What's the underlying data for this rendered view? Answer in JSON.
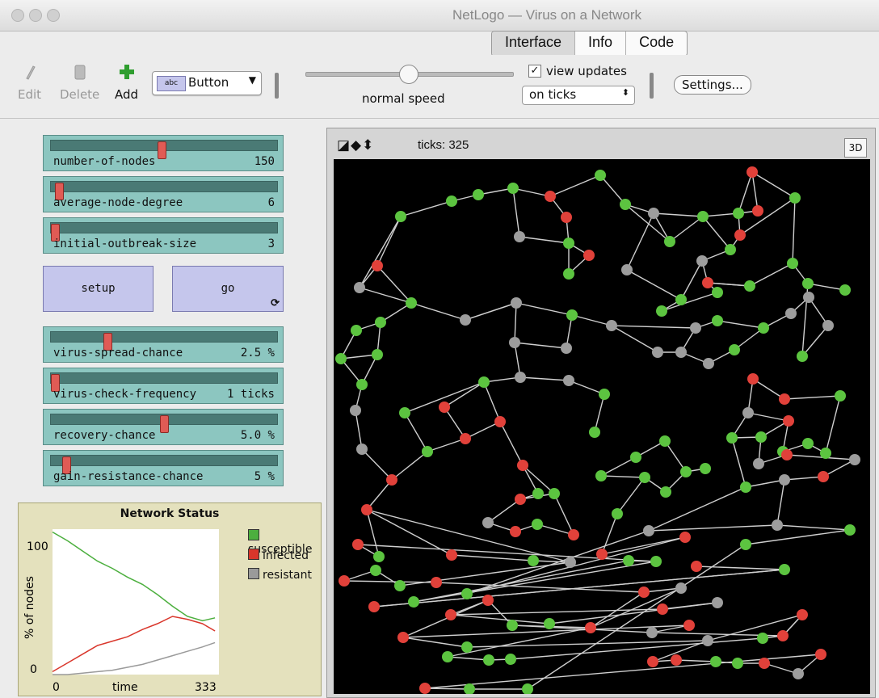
{
  "window": {
    "title": "NetLogo — Virus on a Network"
  },
  "tabs": [
    {
      "label": "Interface"
    },
    {
      "label": "Info"
    },
    {
      "label": "Code"
    }
  ],
  "toolbar": {
    "edit_label": "Edit",
    "delete_label": "Delete",
    "add_label": "Add",
    "widget_type_badge": "abc",
    "widget_type": "Button",
    "speed_label": "normal speed",
    "speed_position": 0.5,
    "view_updates_label": "view updates",
    "view_updates_checked": true,
    "update_mode": "on ticks",
    "settings_label": "Settings..."
  },
  "sliders": [
    {
      "name": "number-of-nodes",
      "value": "150",
      "position": 0.49
    },
    {
      "name": "average-node-degree",
      "value": "6",
      "position": 0.02
    },
    {
      "name": "initial-outbreak-size",
      "value": "3",
      "position": 0.0
    },
    {
      "name": "virus-spread-chance",
      "value": "2.5 %",
      "position": 0.24
    },
    {
      "name": "virus-check-frequency",
      "value": "1 ticks",
      "position": 0.0
    },
    {
      "name": "recovery-chance",
      "value": "5.0 %",
      "position": 0.5
    },
    {
      "name": "gain-resistance-chance",
      "value": "5 %",
      "position": 0.05
    }
  ],
  "buttons": {
    "setup": "setup",
    "go": "go",
    "forever_icon": "forever-icon"
  },
  "plot": {
    "title": "Network Status",
    "ylabel": "% of nodes",
    "xlabel": "time",
    "y_min_label": "0",
    "y_max_label": "100",
    "x_min_label": "0",
    "x_max_label": "333",
    "legend": [
      {
        "name": "susceptible",
        "color": "#4caf3e"
      },
      {
        "name": "infected",
        "color": "#d9362b"
      },
      {
        "name": "resistant",
        "color": "#9a9a9a"
      }
    ]
  },
  "chart_data": {
    "type": "line",
    "title": "Network Status",
    "xlabel": "time",
    "ylabel": "% of nodes",
    "xlim": [
      0,
      333
    ],
    "ylim": [
      0,
      100
    ],
    "x": [
      0,
      30,
      60,
      90,
      120,
      150,
      180,
      210,
      240,
      270,
      300,
      325
    ],
    "series": [
      {
        "name": "susceptible",
        "values": [
          98,
          92,
          85,
          78,
          73,
          67,
          62,
          55,
          47,
          40,
          37,
          39
        ]
      },
      {
        "name": "infected",
        "values": [
          2,
          8,
          14,
          20,
          23,
          26,
          31,
          35,
          40,
          38,
          35,
          30
        ]
      },
      {
        "name": "resistant",
        "values": [
          0,
          0,
          1,
          2,
          3,
          5,
          7,
          10,
          13,
          16,
          19,
          22
        ]
      }
    ],
    "grid": false,
    "legend": "right"
  },
  "view": {
    "ticks_label": "ticks: 325",
    "btn_3d": "3D",
    "background": "#000000"
  },
  "network": {
    "colors": {
      "s": "#5cc440",
      "i": "#e1413a",
      "r": "#9d9d9d"
    },
    "nodes": [
      [
        495,
        267,
        "s"
      ],
      [
        558,
        248,
        "s"
      ],
      [
        591,
        240,
        "s"
      ],
      [
        634,
        232,
        "s"
      ],
      [
        680,
        242,
        "i"
      ],
      [
        700,
        268,
        "i"
      ],
      [
        642,
        292,
        "r"
      ],
      [
        703,
        300,
        "s"
      ],
      [
        728,
        315,
        "i"
      ],
      [
        703,
        338,
        "s"
      ],
      [
        742,
        216,
        "s"
      ],
      [
        773,
        252,
        "s"
      ],
      [
        808,
        263,
        "r"
      ],
      [
        869,
        267,
        "s"
      ],
      [
        913,
        263,
        "s"
      ],
      [
        930,
        212,
        "i"
      ],
      [
        983,
        244,
        "s"
      ],
      [
        937,
        260,
        "i"
      ],
      [
        915,
        290,
        "i"
      ],
      [
        828,
        298,
        "s"
      ],
      [
        903,
        308,
        "s"
      ],
      [
        868,
        322,
        "r"
      ],
      [
        875,
        349,
        "i"
      ],
      [
        980,
        325,
        "s"
      ],
      [
        999,
        350,
        "s"
      ],
      [
        1045,
        358,
        "s"
      ],
      [
        927,
        353,
        "s"
      ],
      [
        775,
        333,
        "r"
      ],
      [
        842,
        370,
        "s"
      ],
      [
        818,
        384,
        "s"
      ],
      [
        887,
        361,
        "s"
      ],
      [
        466,
        328,
        "i"
      ],
      [
        444,
        355,
        "r"
      ],
      [
        508,
        374,
        "s"
      ],
      [
        470,
        398,
        "s"
      ],
      [
        440,
        408,
        "s"
      ],
      [
        421,
        443,
        "s"
      ],
      [
        466,
        438,
        "s"
      ],
      [
        447,
        475,
        "s"
      ],
      [
        439,
        507,
        "r"
      ],
      [
        447,
        555,
        "r"
      ],
      [
        575,
        395,
        "r"
      ],
      [
        638,
        374,
        "r"
      ],
      [
        707,
        389,
        "s"
      ],
      [
        756,
        402,
        "r"
      ],
      [
        860,
        405,
        "r"
      ],
      [
        887,
        396,
        "s"
      ],
      [
        944,
        405,
        "s"
      ],
      [
        978,
        387,
        "r"
      ],
      [
        1000,
        367,
        "r"
      ],
      [
        1024,
        402,
        "r"
      ],
      [
        992,
        440,
        "s"
      ],
      [
        636,
        423,
        "r"
      ],
      [
        700,
        430,
        "r"
      ],
      [
        813,
        435,
        "r"
      ],
      [
        842,
        435,
        "r"
      ],
      [
        876,
        449,
        "r"
      ],
      [
        908,
        432,
        "s"
      ],
      [
        643,
        466,
        "r"
      ],
      [
        703,
        470,
        "r"
      ],
      [
        747,
        487,
        "s"
      ],
      [
        598,
        472,
        "s"
      ],
      [
        735,
        534,
        "s"
      ],
      [
        549,
        503,
        "i"
      ],
      [
        575,
        542,
        "i"
      ],
      [
        618,
        521,
        "i"
      ],
      [
        528,
        558,
        "s"
      ],
      [
        500,
        510,
        "s"
      ],
      [
        931,
        468,
        "i"
      ],
      [
        970,
        493,
        "i"
      ],
      [
        1039,
        489,
        "s"
      ],
      [
        925,
        510,
        "r"
      ],
      [
        975,
        520,
        "i"
      ],
      [
        941,
        540,
        "s"
      ],
      [
        905,
        541,
        "s"
      ],
      [
        968,
        558,
        "s"
      ],
      [
        999,
        548,
        "s"
      ],
      [
        1021,
        560,
        "s"
      ],
      [
        938,
        573,
        "r"
      ],
      [
        973,
        562,
        "i"
      ],
      [
        1057,
        568,
        "r"
      ],
      [
        1018,
        589,
        "i"
      ],
      [
        970,
        593,
        "r"
      ],
      [
        922,
        602,
        "s"
      ],
      [
        822,
        545,
        "s"
      ],
      [
        848,
        583,
        "s"
      ],
      [
        872,
        579,
        "s"
      ],
      [
        786,
        565,
        "s"
      ],
      [
        743,
        588,
        "s"
      ],
      [
        797,
        590,
        "s"
      ],
      [
        823,
        608,
        "s"
      ],
      [
        763,
        635,
        "s"
      ],
      [
        484,
        593,
        "i"
      ],
      [
        646,
        575,
        "i"
      ],
      [
        665,
        610,
        "s"
      ],
      [
        643,
        617,
        "i"
      ],
      [
        685,
        610,
        "s"
      ],
      [
        603,
        646,
        "r"
      ],
      [
        637,
        657,
        "i"
      ],
      [
        664,
        648,
        "s"
      ],
      [
        709,
        661,
        "i"
      ],
      [
        453,
        630,
        "i"
      ],
      [
        961,
        649,
        "r"
      ],
      [
        1051,
        655,
        "s"
      ],
      [
        922,
        673,
        "s"
      ],
      [
        802,
        656,
        "r"
      ],
      [
        847,
        664,
        "i"
      ],
      [
        744,
        685,
        "i"
      ],
      [
        777,
        693,
        "s"
      ],
      [
        811,
        694,
        "s"
      ],
      [
        442,
        673,
        "i"
      ],
      [
        468,
        688,
        "s"
      ],
      [
        558,
        686,
        "i"
      ],
      [
        659,
        693,
        "s"
      ],
      [
        705,
        695,
        "r"
      ],
      [
        425,
        718,
        "i"
      ],
      [
        464,
        705,
        "s"
      ],
      [
        494,
        724,
        "s"
      ],
      [
        539,
        720,
        "i"
      ],
      [
        796,
        732,
        "i"
      ],
      [
        842,
        727,
        "r"
      ],
      [
        861,
        700,
        "i"
      ],
      [
        970,
        704,
        "s"
      ],
      [
        462,
        750,
        "i"
      ],
      [
        511,
        744,
        "s"
      ],
      [
        577,
        734,
        "s"
      ],
      [
        603,
        742,
        "i"
      ],
      [
        557,
        760,
        "i"
      ],
      [
        819,
        753,
        "i"
      ],
      [
        887,
        745,
        "r"
      ],
      [
        679,
        771,
        "s"
      ],
      [
        730,
        776,
        "i"
      ],
      [
        633,
        773,
        "s"
      ],
      [
        806,
        782,
        "r"
      ],
      [
        852,
        773,
        "i"
      ],
      [
        498,
        788,
        "i"
      ],
      [
        577,
        800,
        "s"
      ],
      [
        553,
        812,
        "s"
      ],
      [
        604,
        816,
        "s"
      ],
      [
        631,
        815,
        "s"
      ],
      [
        943,
        789,
        "s"
      ],
      [
        968,
        786,
        "i"
      ],
      [
        992,
        760,
        "i"
      ],
      [
        875,
        792,
        "r"
      ],
      [
        807,
        818,
        "i"
      ],
      [
        836,
        816,
        "i"
      ],
      [
        885,
        818,
        "s"
      ],
      [
        912,
        820,
        "s"
      ],
      [
        945,
        820,
        "i"
      ],
      [
        987,
        833,
        "r"
      ],
      [
        1015,
        809,
        "i"
      ],
      [
        525,
        851,
        "i"
      ],
      [
        580,
        852,
        "s"
      ],
      [
        652,
        852,
        "s"
      ]
    ],
    "edges": [
      [
        0,
        1
      ],
      [
        1,
        2
      ],
      [
        2,
        3
      ],
      [
        3,
        4
      ],
      [
        4,
        5
      ],
      [
        5,
        7
      ],
      [
        7,
        8
      ],
      [
        8,
        9
      ],
      [
        9,
        7
      ],
      [
        3,
        6
      ],
      [
        6,
        7
      ],
      [
        4,
        10
      ],
      [
        10,
        11
      ],
      [
        11,
        12
      ],
      [
        12,
        13
      ],
      [
        13,
        14
      ],
      [
        14,
        15
      ],
      [
        15,
        16
      ],
      [
        15,
        17
      ],
      [
        17,
        14
      ],
      [
        14,
        18
      ],
      [
        18,
        16
      ],
      [
        18,
        20
      ],
      [
        20,
        13
      ],
      [
        13,
        19
      ],
      [
        19,
        11
      ],
      [
        19,
        12
      ],
      [
        20,
        21
      ],
      [
        21,
        22
      ],
      [
        22,
        26
      ],
      [
        23,
        16
      ],
      [
        23,
        24
      ],
      [
        24,
        25
      ],
      [
        23,
        26
      ],
      [
        26,
        22
      ],
      [
        12,
        27
      ],
      [
        27,
        28
      ],
      [
        28,
        29
      ],
      [
        29,
        30
      ],
      [
        30,
        22
      ],
      [
        21,
        28
      ],
      [
        0,
        31
      ],
      [
        31,
        32
      ],
      [
        32,
        33
      ],
      [
        31,
        33
      ],
      [
        33,
        34
      ],
      [
        34,
        35
      ],
      [
        35,
        36
      ],
      [
        36,
        37
      ],
      [
        37,
        34
      ],
      [
        36,
        38
      ],
      [
        38,
        39
      ],
      [
        39,
        40
      ],
      [
        37,
        38
      ],
      [
        0,
        32
      ],
      [
        33,
        41
      ],
      [
        41,
        42
      ],
      [
        42,
        43
      ],
      [
        43,
        44
      ],
      [
        44,
        45
      ],
      [
        45,
        46
      ],
      [
        46,
        47
      ],
      [
        47,
        48
      ],
      [
        48,
        49
      ],
      [
        49,
        50
      ],
      [
        50,
        51
      ],
      [
        51,
        24
      ],
      [
        41,
        42
      ],
      [
        42,
        52
      ],
      [
        52,
        53
      ],
      [
        53,
        43
      ],
      [
        44,
        54
      ],
      [
        54,
        55
      ],
      [
        55,
        56
      ],
      [
        56,
        57
      ],
      [
        57,
        47
      ],
      [
        45,
        55
      ],
      [
        52,
        58
      ],
      [
        58,
        59
      ],
      [
        59,
        60
      ],
      [
        60,
        62
      ],
      [
        58,
        61
      ],
      [
        61,
        63
      ],
      [
        63,
        64
      ],
      [
        64,
        65
      ],
      [
        65,
        61
      ],
      [
        64,
        66
      ],
      [
        66,
        67
      ],
      [
        67,
        61
      ],
      [
        68,
        69
      ],
      [
        69,
        70
      ],
      [
        68,
        71
      ],
      [
        71,
        72
      ],
      [
        72,
        73
      ],
      [
        73,
        74
      ],
      [
        74,
        71
      ],
      [
        72,
        75
      ],
      [
        75,
        76
      ],
      [
        76,
        77
      ],
      [
        77,
        70
      ],
      [
        73,
        78
      ],
      [
        78,
        79
      ],
      [
        79,
        75
      ],
      [
        79,
        80
      ],
      [
        80,
        81
      ],
      [
        81,
        82
      ],
      [
        82,
        83
      ],
      [
        83,
        74
      ],
      [
        84,
        85
      ],
      [
        85,
        86
      ],
      [
        84,
        87
      ],
      [
        87,
        88
      ],
      [
        88,
        89
      ],
      [
        89,
        90
      ],
      [
        90,
        85
      ],
      [
        89,
        91
      ],
      [
        66,
        92
      ],
      [
        92,
        40
      ],
      [
        65,
        93
      ],
      [
        93,
        94
      ],
      [
        94,
        95
      ],
      [
        95,
        96
      ],
      [
        96,
        93
      ],
      [
        95,
        97
      ],
      [
        97,
        98
      ],
      [
        98,
        99
      ],
      [
        99,
        100
      ],
      [
        100,
        96
      ],
      [
        92,
        101
      ],
      [
        101,
        111
      ],
      [
        102,
        103
      ],
      [
        103,
        104
      ],
      [
        82,
        102
      ],
      [
        83,
        105
      ],
      [
        105,
        102
      ],
      [
        106,
        107
      ],
      [
        107,
        91
      ],
      [
        108,
        109
      ],
      [
        109,
        110
      ],
      [
        110,
        111
      ],
      [
        101,
        112
      ],
      [
        112,
        113
      ],
      [
        113,
        114
      ],
      [
        114,
        101
      ],
      [
        115,
        116
      ],
      [
        116,
        117
      ],
      [
        115,
        118
      ],
      [
        118,
        119
      ],
      [
        119,
        120
      ],
      [
        121,
        122
      ],
      [
        122,
        123
      ],
      [
        108,
        124
      ],
      [
        124,
        109
      ],
      [
        125,
        105
      ],
      [
        126,
        127
      ],
      [
        127,
        128
      ],
      [
        128,
        129
      ],
      [
        129,
        130
      ],
      [
        130,
        127
      ],
      [
        114,
        117
      ],
      [
        119,
        131
      ],
      [
        131,
        132
      ],
      [
        132,
        133
      ],
      [
        133,
        134
      ],
      [
        134,
        135
      ],
      [
        135,
        136
      ],
      [
        137,
        138
      ],
      [
        138,
        139
      ],
      [
        139,
        140
      ],
      [
        140,
        141
      ],
      [
        141,
        142
      ],
      [
        142,
        143
      ],
      [
        143,
        144
      ],
      [
        144,
        145
      ],
      [
        145,
        146
      ],
      [
        146,
        147
      ],
      [
        147,
        148
      ],
      [
        148,
        149
      ],
      [
        149,
        150
      ],
      [
        150,
        151
      ],
      [
        151,
        152
      ],
      [
        152,
        153
      ],
      [
        153,
        154
      ],
      [
        154,
        155
      ],
      [
        156,
        157
      ],
      [
        157,
        158
      ],
      [
        158,
        139
      ],
      [
        120,
        131
      ],
      [
        131,
        137
      ],
      [
        137,
        156
      ],
      [
        133,
        141
      ],
      [
        141,
        142
      ],
      [
        136,
        143
      ],
      [
        104,
        153
      ],
      [
        153,
        154
      ],
      [
        123,
        122
      ],
      [
        106,
        125
      ],
      [
        126,
        135
      ],
      [
        126,
        132
      ],
      [
        129,
        157
      ]
    ]
  }
}
